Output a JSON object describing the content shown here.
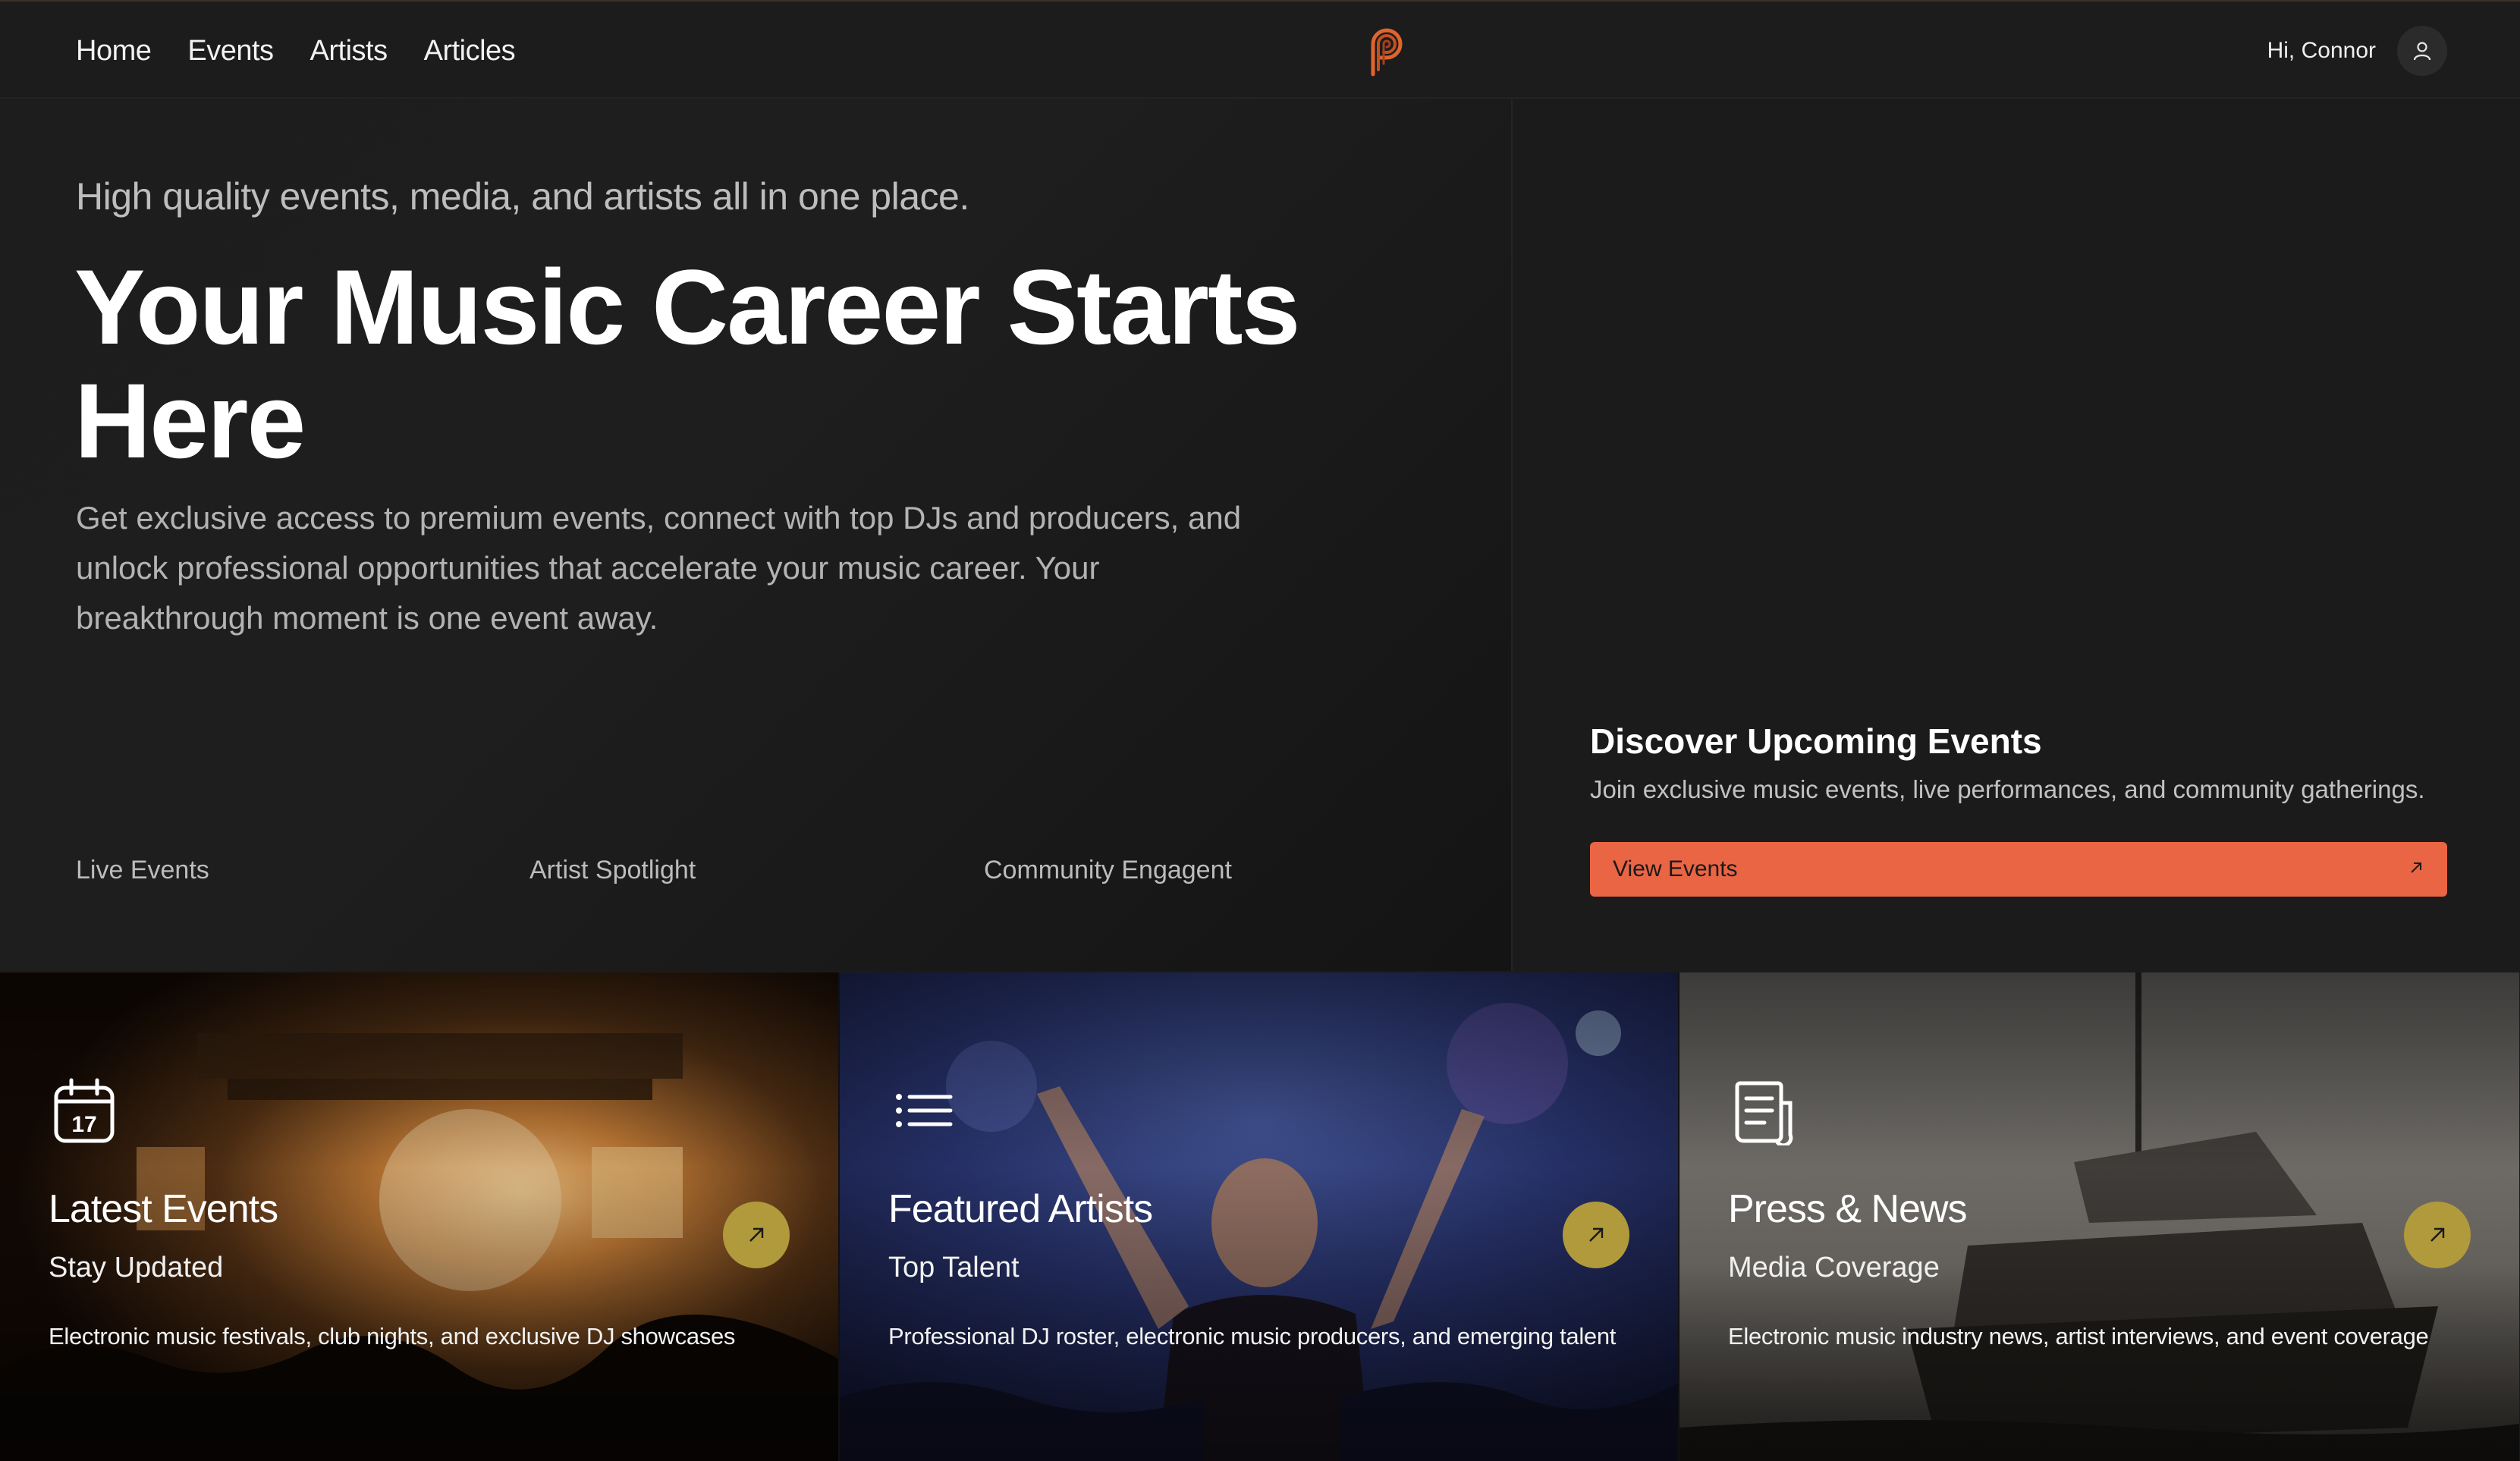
{
  "nav": {
    "links": [
      "Home",
      "Events",
      "Artists",
      "Articles"
    ],
    "greeting": "Hi, Connor",
    "logo_icon": "p-logo-icon",
    "user_icon": "user-icon"
  },
  "hero": {
    "tagline": "High quality events, media, and artists all in one place.",
    "headline": "Your Music Career Starts Here",
    "lead": "Get exclusive access to premium events, connect with top DJs and producers, and unlock professional opportunities that accelerate your music career. Your breakthrough moment is one event away.",
    "features": [
      "Live Events",
      "Artist Spotlight",
      "Community Engagent"
    ]
  },
  "discover": {
    "title": "Discover Upcoming Events",
    "description": "Join exclusive music events, live performances, and community gatherings.",
    "button_label": "View Events",
    "button_icon": "arrow-up-right-icon"
  },
  "cards": [
    {
      "title": "Latest Events",
      "subtitle": "Stay Updated",
      "description": "Electronic music festivals, club nights, and exclusive DJ showcases",
      "icon": "calendar-icon",
      "calendar_day": "17"
    },
    {
      "title": "Featured Artists",
      "subtitle": "Top Talent",
      "description": "Professional DJ roster, electronic music producers, and emerging talent",
      "icon": "list-icon"
    },
    {
      "title": "Press & News",
      "subtitle": "Media Coverage",
      "description": "Electronic music industry news, artist interviews, and event coverage",
      "icon": "newspaper-icon"
    }
  ],
  "colors": {
    "accent": "#ea6544",
    "arrow_button": "#b09a3c",
    "background": "#1b1b1b"
  }
}
